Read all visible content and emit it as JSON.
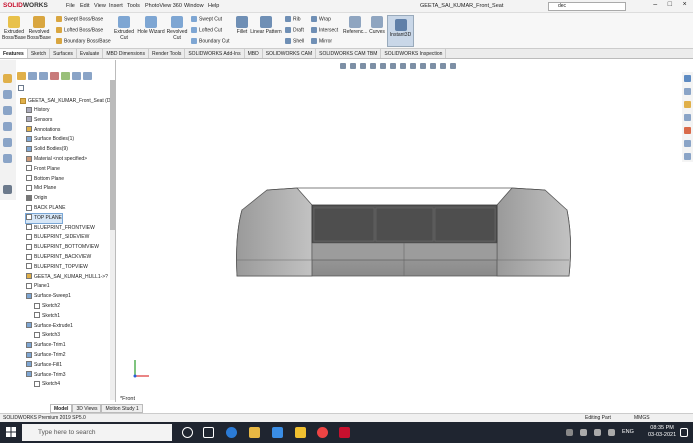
{
  "titlebar": {
    "logo_main": "SOLID",
    "logo_sub": "WORKS",
    "menus": [
      "File",
      "Edit",
      "View",
      "Insert",
      "Tools",
      "PhotoView 360",
      "Window",
      "Help"
    ],
    "document_title": "GEETA_SAI_KUMAR_Front_Seat",
    "search_value": "dec"
  },
  "ribbon": {
    "extruded_boss": "Extruded Boss/Base",
    "revolved_boss": "Revolved Boss/Base",
    "swept_boss": "Swept Boss/Base",
    "lofted_boss": "Lofted Boss/Base",
    "boundary_boss": "Boundary Boss/Base",
    "extruded_cut": "Extruded Cut",
    "hole_wizard": "Hole Wizard",
    "revolved_cut": "Revolved Cut",
    "swept_cut": "Swept Cut",
    "lofted_cut": "Lofted Cut",
    "boundary_cut": "Boundary Cut",
    "fillet": "Fillet",
    "linear_pattern": "Linear Pattern",
    "rib": "Rib",
    "draft": "Draft",
    "shell": "Shell",
    "wrap": "Wrap",
    "intersect": "Intersect",
    "mirror": "Mirror",
    "reference": "Referenc...",
    "curves": "Curves",
    "instant3d": "Instant3D"
  },
  "tabs": [
    "Features",
    "Sketch",
    "Surfaces",
    "Evaluate",
    "MBD Dimensions",
    "Render Tools",
    "SOLIDWORKS Add-Ins",
    "MBD",
    "SOLIDWORKS CAM",
    "SOLIDWORKS CAM TBM",
    "SOLIDWORKS Inspection"
  ],
  "tree": {
    "root": "GEETA_SAI_KUMAR_Front_Seat (D",
    "items": [
      {
        "label": "History",
        "indent": 1
      },
      {
        "label": "Sensors",
        "indent": 1
      },
      {
        "label": "Annotations",
        "indent": 1
      },
      {
        "label": "Surface Bodies(1)",
        "indent": 1
      },
      {
        "label": "Solid Bodies(9)",
        "indent": 1
      },
      {
        "label": "Material <not specified>",
        "indent": 1
      },
      {
        "label": "Front Plane",
        "indent": 1
      },
      {
        "label": "Bottom Plane",
        "indent": 1
      },
      {
        "label": "Mid Plane",
        "indent": 1
      },
      {
        "label": "Origin",
        "indent": 1
      },
      {
        "label": "BACK PLANE",
        "indent": 1
      },
      {
        "label": "TOP PLANE",
        "indent": 1
      },
      {
        "label": "BLUEPRINT_FRONTVIEW",
        "indent": 1
      },
      {
        "label": "BLUEPRINT_SIDEVIEW",
        "indent": 1
      },
      {
        "label": "BLUEPRINT_BOTTOMVIEW",
        "indent": 1
      },
      {
        "label": "BLUEPRINT_BACKVIEW",
        "indent": 1
      },
      {
        "label": "BLUEPRINT_TOPVIEW",
        "indent": 1
      },
      {
        "label": "GEETA_SAI_KUMAR_HULL1->?",
        "indent": 1
      },
      {
        "label": "Plane1",
        "indent": 1
      },
      {
        "label": "Surface-Sweep1",
        "indent": 1
      },
      {
        "label": "Sketch2",
        "indent": 2
      },
      {
        "label": "Sketch1",
        "indent": 2
      },
      {
        "label": "Surface-Extrude1",
        "indent": 1
      },
      {
        "label": "Sketch3",
        "indent": 2
      },
      {
        "label": "Surface-Trim1",
        "indent": 1
      },
      {
        "label": "Surface-Trim2",
        "indent": 1
      },
      {
        "label": "Surface-Fill1",
        "indent": 1
      },
      {
        "label": "Surface-Trim3",
        "indent": 1
      },
      {
        "label": "Sketch4",
        "indent": 2
      }
    ],
    "selected_index": 11
  },
  "viewport": {
    "view_label": "*Front"
  },
  "model_tabs": [
    "Model",
    "3D Views",
    "Motion Study 1"
  ],
  "status": {
    "left": "SOLIDWORKS Premium 2019 SP5.0",
    "mode": "Editing Part",
    "units": "MMGS"
  },
  "taskbar": {
    "search_placeholder": "Type here to search",
    "lang": "ENG",
    "time": "08:35 PM",
    "date": "03-03-2021"
  }
}
